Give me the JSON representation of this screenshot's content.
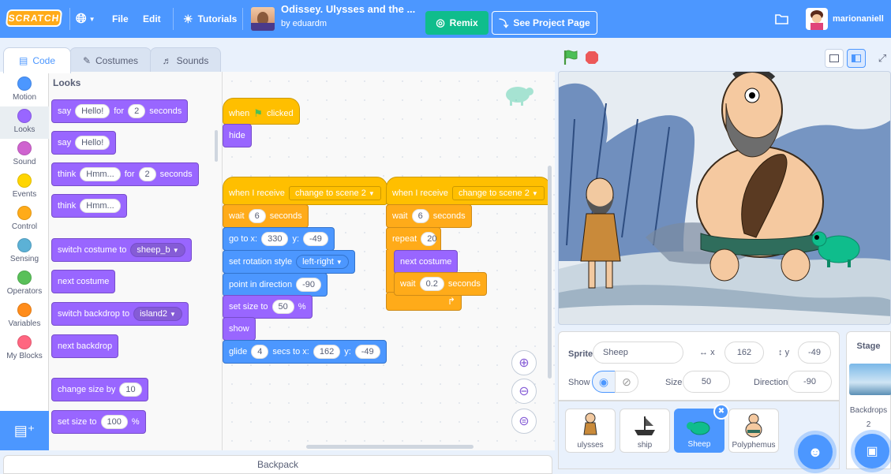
{
  "menubar": {
    "logo": "SCRATCH",
    "file": "File",
    "edit": "Edit",
    "tutorials": "Tutorials",
    "project_title": "Odissey. Ulysses and the ...",
    "author": "by eduardm",
    "remix": "Remix",
    "see_project_page": "See Project Page",
    "username": "marionaniell"
  },
  "tabs": {
    "code": "Code",
    "costumes": "Costumes",
    "sounds": "Sounds"
  },
  "categories": [
    {
      "label": "Motion",
      "color": "#4c97ff"
    },
    {
      "label": "Looks",
      "color": "#9966ff"
    },
    {
      "label": "Sound",
      "color": "#cf63cf"
    },
    {
      "label": "Events",
      "color": "#ffd500"
    },
    {
      "label": "Control",
      "color": "#ffab19"
    },
    {
      "label": "Sensing",
      "color": "#5cb1d6"
    },
    {
      "label": "Operators",
      "color": "#59c059"
    },
    {
      "label": "Variables",
      "color": "#ff8c1a"
    },
    {
      "label": "My Blocks",
      "color": "#ff6680"
    }
  ],
  "palette": {
    "title": "Looks",
    "say_for": {
      "say": "say",
      "msg": "Hello!",
      "for": "for",
      "secs": "2",
      "seconds": "seconds"
    },
    "say": {
      "say": "say",
      "msg": "Hello!"
    },
    "think_for": {
      "think": "think",
      "msg": "Hmm...",
      "for": "for",
      "secs": "2",
      "seconds": "seconds"
    },
    "think": {
      "think": "think",
      "msg": "Hmm..."
    },
    "switch_costume": {
      "label": "switch costume to",
      "value": "sheep_b"
    },
    "next_costume": "next costume",
    "switch_backdrop": {
      "label": "switch backdrop to",
      "value": "island2"
    },
    "next_backdrop": "next backdrop",
    "change_size": {
      "label": "change size by",
      "value": "10"
    },
    "set_size": {
      "label": "set size to",
      "value": "100",
      "unit": "%"
    }
  },
  "script1": {
    "when": "when",
    "clicked": "clicked",
    "hide": "hide"
  },
  "script2": {
    "receive": "when I receive",
    "msg": "change to scene 2",
    "wait": "wait",
    "wait_val": "6",
    "seconds": "seconds",
    "goto": "go to x:",
    "x": "330",
    "ylabel": "y:",
    "y": "-49",
    "rot": "set rotation style",
    "rot_val": "left-right",
    "point": "point in direction",
    "dir": "-90",
    "size": "set size to",
    "size_val": "50",
    "pct": "%",
    "show": "show",
    "glide": "glide",
    "glide_secs": "4",
    "glide_to": "secs to x:",
    "gx": "162",
    "gy": "-49"
  },
  "script3": {
    "receive": "when I receive",
    "msg": "change to scene 2",
    "wait": "wait",
    "wait_val": "6",
    "seconds": "seconds",
    "repeat": "repeat",
    "repeat_val": "20",
    "next_costume": "next costume",
    "wait2": "wait",
    "wait2_val": "0.2",
    "seconds2": "seconds"
  },
  "backpack": "Backpack",
  "sprite_info": {
    "sprite_label": "Sprite",
    "sprite_name": "Sheep",
    "x_label": "x",
    "x": "162",
    "y_label": "y",
    "y": "-49",
    "show_label": "Show",
    "size_label": "Size",
    "size": "50",
    "direction_label": "Direction",
    "direction": "-90"
  },
  "sprites": [
    "ulysses",
    "ship",
    "Sheep",
    "Polyphemus"
  ],
  "stage_panel": {
    "title": "Stage",
    "backdrops_label": "Backdrops",
    "backdrops_count": "2"
  }
}
